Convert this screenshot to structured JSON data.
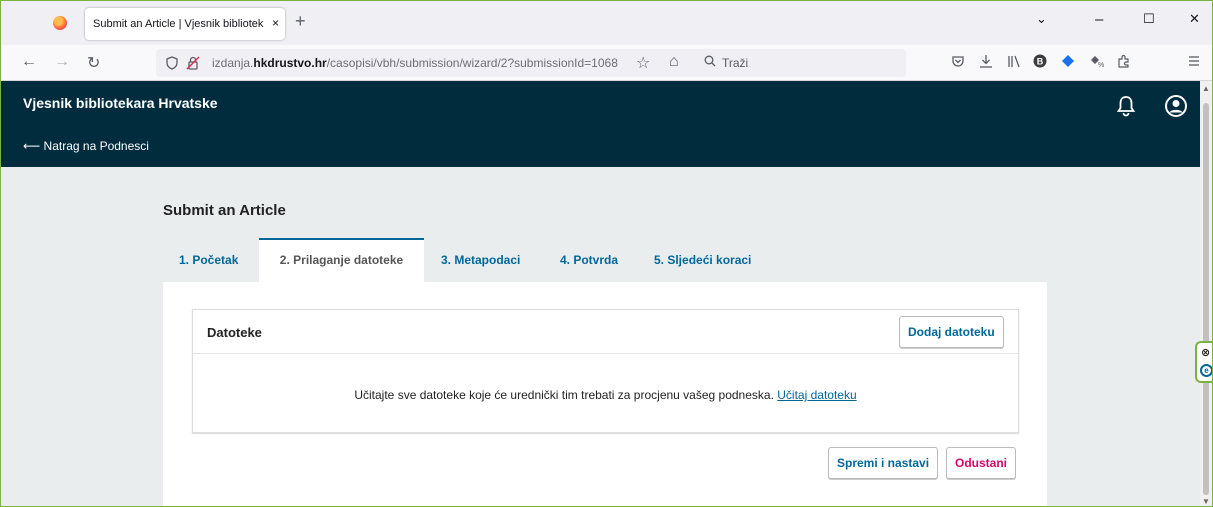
{
  "browser": {
    "tab_title": "Submit an Article | Vjesnik bibliotek",
    "tab_close": "×",
    "new_tab": "+",
    "url_host_pre": "izdanja.",
    "url_host_bold": "hkdrustvo.hr",
    "url_path": "/casopisi/vbh/submission/wizard/2?submissionId=1068",
    "search_placeholder": "Traži",
    "window_min": "–",
    "window_max": "☐",
    "window_close": "✕",
    "tab_list": "⌄",
    "back": "←",
    "forward": "→",
    "reload": "↻",
    "bookmark_star": "☆",
    "home": "⌂"
  },
  "header": {
    "site_title": "Vjesnik bibliotekara Hrvatske",
    "back_link": "⟵ Natrag na Podnesci"
  },
  "main": {
    "title": "Submit an Article",
    "steps": [
      {
        "label": "1. Početak"
      },
      {
        "label": "2. Prilaganje datoteke"
      },
      {
        "label": "3. Metapodaci"
      },
      {
        "label": "4. Potvrda"
      },
      {
        "label": "5. Sljedeći koraci"
      }
    ],
    "files": {
      "title": "Datoteke",
      "add_button": "Dodaj datoteku",
      "message": "Učitajte sve datoteke koje će urednički tim trebati za procjenu vašeg podneska.",
      "upload_link": "Učitaj datoteku"
    },
    "save_button": "Spremi i nastavi",
    "cancel_button": "Odustani"
  },
  "colors": {
    "header_bg": "#002c3e",
    "link": "#006798",
    "cancel": "#d00a6c",
    "page_bg": "#eaedee"
  }
}
